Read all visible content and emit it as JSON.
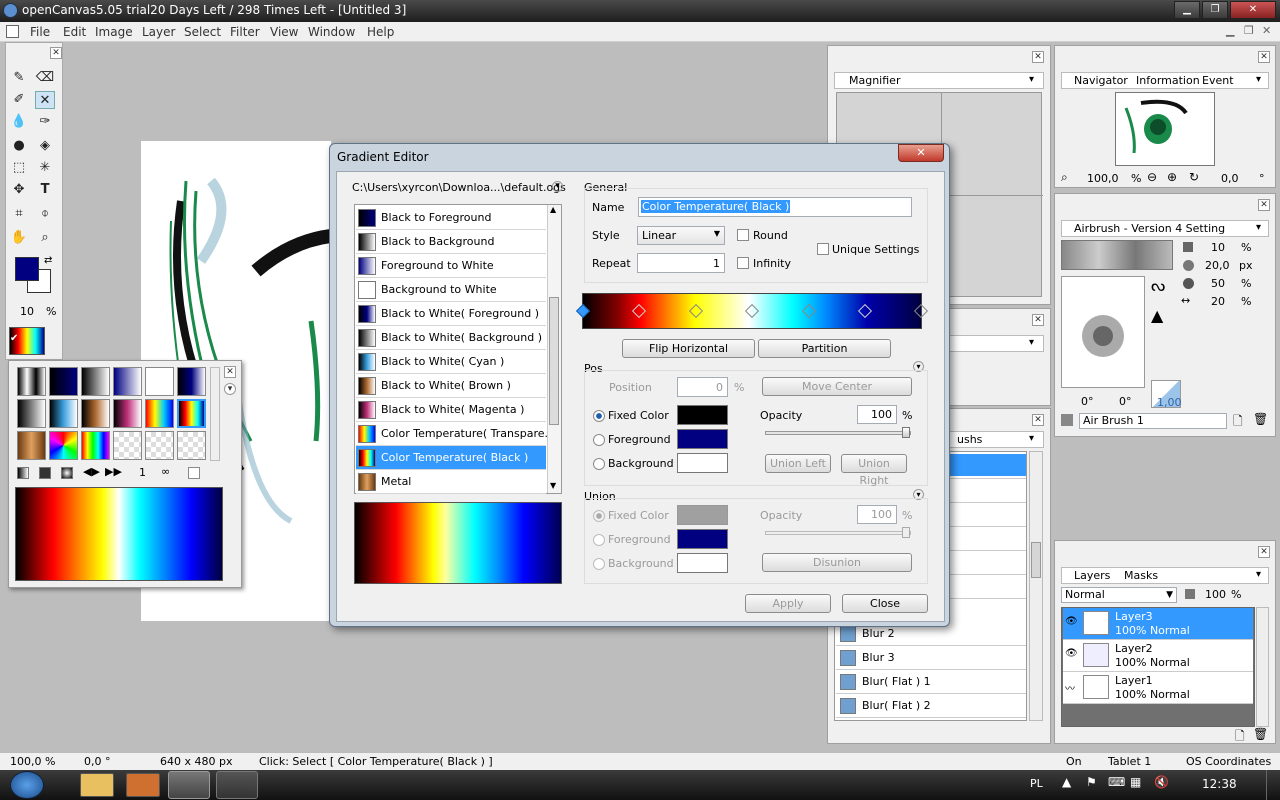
{
  "window": {
    "title": "openCanvas5.05 trial20 Days Left / 298 Times Left - [Untitled 3]"
  },
  "menu": [
    "File",
    "Edit",
    "Image",
    "Layer",
    "Select",
    "Filter",
    "View",
    "Window",
    "Help"
  ],
  "toolbox": {
    "brush_size": "10",
    "brush_unit": "%"
  },
  "swatch_panel": {
    "page_value": "1"
  },
  "magnifier": {
    "tab": "Magnifier"
  },
  "navigator": {
    "tabs": [
      "Navigator",
      "Information",
      "Event"
    ],
    "zoom": "100,0",
    "zoom_unit": "%",
    "angle": "0,0",
    "angle_unit": "°"
  },
  "airbrush": {
    "tab": "Airbrush - Version 4 Setting",
    "params": [
      {
        "value": "10",
        "unit": "%"
      },
      {
        "value": "20,0",
        "unit": "px"
      },
      {
        "value": "50",
        "unit": "%"
      },
      {
        "value": "20",
        "unit": "%"
      }
    ],
    "angle_a": "0°",
    "angle_b": "0°",
    "ratio": "1,00",
    "name": "Air Brush 1"
  },
  "brushes": {
    "tab_partial": "ushs",
    "items": [
      "Blur 2",
      "Blur 3",
      "Blur( Flat ) 1",
      "Blur( Flat ) 2"
    ]
  },
  "layers": {
    "tabs": [
      "Layers",
      "Masks"
    ],
    "blend": "Normal",
    "opacity": "100",
    "opacity_unit": "%",
    "items": [
      {
        "name": "Layer3",
        "info": "100% Normal",
        "selected": true
      },
      {
        "name": "Layer2",
        "info": "100% Normal",
        "selected": false
      },
      {
        "name": "Layer1",
        "info": "100% Normal",
        "selected": false
      }
    ]
  },
  "gradient_editor": {
    "title": "Gradient Editor",
    "path": "C:\\Users\\xyrcon\\Downloa...\\default.ogs",
    "gradients": [
      {
        "label": "Black to Foreground",
        "colors": [
          "#000000",
          "#000080"
        ]
      },
      {
        "label": "Black to Background",
        "colors": [
          "#000000",
          "#ffffff"
        ]
      },
      {
        "label": "Foreground to White",
        "colors": [
          "#000080",
          "#ffffff"
        ]
      },
      {
        "label": "Background to White",
        "colors": [
          "#ffffff",
          "#ffffff"
        ]
      },
      {
        "label": "Black to White( Foreground )",
        "colors": [
          "#000000",
          "#000080",
          "#ffffff"
        ]
      },
      {
        "label": "Black to White( Background )",
        "colors": [
          "#000000",
          "#ffffff"
        ]
      },
      {
        "label": "Black to White( Cyan )",
        "colors": [
          "#000000",
          "#3aa0e0",
          "#ffffff"
        ]
      },
      {
        "label": "Black to White( Brown )",
        "colors": [
          "#000000",
          "#b06a30",
          "#ffffff"
        ]
      },
      {
        "label": "Black to White( Magenta )",
        "colors": [
          "#000000",
          "#c0307a",
          "#ffffff"
        ]
      },
      {
        "label": "Color Temperature( Transpare...",
        "colors": [
          "#ff0000",
          "#ffff00",
          "#00c0ff",
          "#0000ff"
        ]
      },
      {
        "label": "Color Temperature( Black )",
        "colors": [
          "#000000",
          "#ff0000",
          "#ffff00",
          "#00ffff",
          "#000080"
        ]
      },
      {
        "label": "Metal",
        "colors": [
          "#6a3a10",
          "#e0a060",
          "#6a3a10"
        ]
      }
    ],
    "selected_index": 10,
    "general": {
      "heading": "General",
      "name_label": "Name",
      "name_value": "Color Temperature( Black )",
      "style_label": "Style",
      "style_value": "Linear",
      "round_label": "Round",
      "repeat_label": "Repeat",
      "repeat_value": "1",
      "infinity_label": "Infinity",
      "unique_label": "Unique Settings"
    },
    "flip_label": "Flip Horizontal",
    "partition_label": "Partition",
    "pos": {
      "heading": "Pos",
      "position_label": "Position",
      "position_value": "0",
      "position_unit": "%",
      "move_center_label": "Move Center",
      "fixed_color_label": "Fixed Color",
      "foreground_label": "Foreground",
      "background_label": "Background",
      "opacity_label": "Opacity",
      "opacity_value": "100",
      "opacity_unit": "%",
      "union_left_label": "Union Left",
      "union_right_label": "Union Right"
    },
    "union": {
      "heading": "Union",
      "fixed_color_label": "Fixed Color",
      "foreground_label": "Foreground",
      "background_label": "Background",
      "opacity_label": "Opacity",
      "opacity_value": "100",
      "opacity_unit": "%",
      "disunion_label": "Disunion"
    },
    "apply_label": "Apply",
    "close_label": "Close"
  },
  "status": {
    "zoom": "100,0 %",
    "angle": "0,0 °",
    "size": "640 x 480 px",
    "message": "Click: Select [ Color Temperature( Black ) ]",
    "pressure": "On",
    "tablet": "Tablet 1",
    "coords": "OS Coordinates"
  },
  "taskbar": {
    "lang": "PL",
    "time": "12:38"
  }
}
